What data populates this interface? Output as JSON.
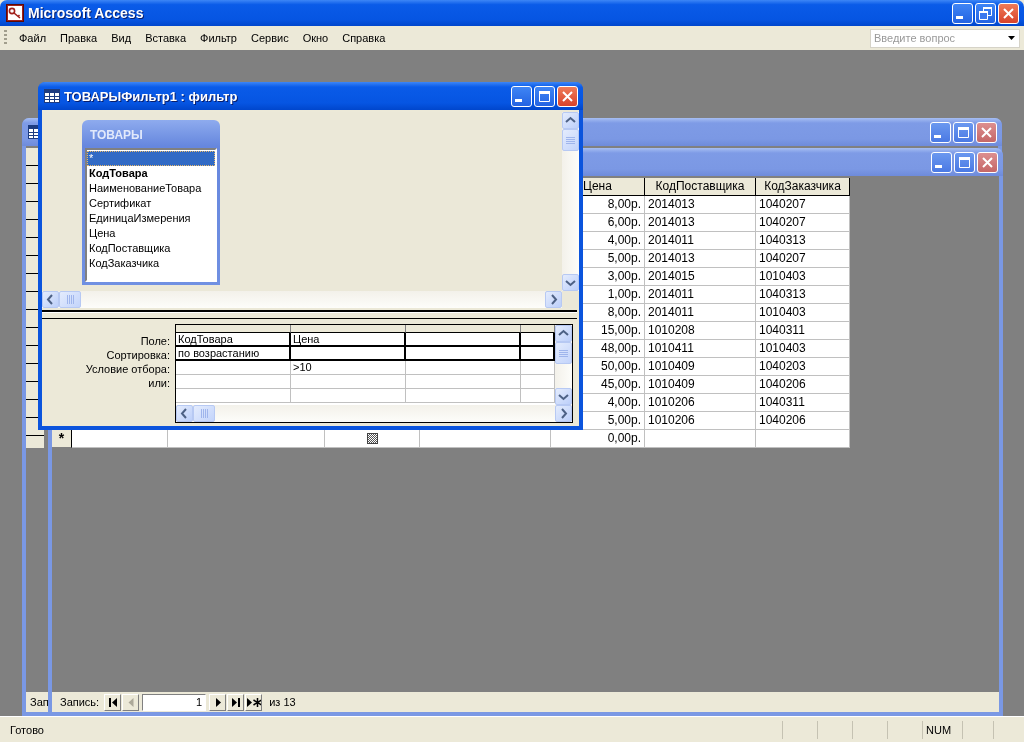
{
  "app": {
    "title": "Microsoft Access",
    "menu": [
      "Файл",
      "Правка",
      "Вид",
      "Вставка",
      "Фильтр",
      "Сервис",
      "Окно",
      "Справка"
    ],
    "help_box": {
      "placeholder": "Введите вопрос"
    }
  },
  "back_window": {
    "navigator_label": "Зап"
  },
  "datasheet_window": {
    "columns": [
      "Цена",
      "КодПоставщика",
      "КодЗаказчика"
    ],
    "rows": [
      [
        "8,00р.",
        "2014013",
        "1040207"
      ],
      [
        "6,00р.",
        "2014013",
        "1040207"
      ],
      [
        "4,00р.",
        "2014011",
        "1040313"
      ],
      [
        "5,00р.",
        "2014013",
        "1040207"
      ],
      [
        "3,00р.",
        "2014015",
        "1010403"
      ],
      [
        "1,00р.",
        "2014011",
        "1040313"
      ],
      [
        "8,00р.",
        "2014011",
        "1010403"
      ],
      [
        "15,00р.",
        "1010208",
        "1040311"
      ],
      [
        "48,00р.",
        "1010411",
        "1010403"
      ],
      [
        "50,00р.",
        "1010409",
        "1040203"
      ],
      [
        "45,00р.",
        "1010409",
        "1040206"
      ],
      [
        "4,00р.",
        "1010206",
        "1040311"
      ],
      [
        "5,00р.",
        "1010206",
        "1040206"
      ]
    ],
    "new_row": {
      "marker": "*",
      "checkbox": {
        "indeterminate": true
      },
      "values": [
        "0,00р."
      ]
    },
    "navigator": {
      "label": "Запись:",
      "current": "1",
      "total": "из 13",
      "buttons": [
        {
          "kind": "first",
          "disabled": false
        },
        {
          "kind": "prev",
          "disabled": true
        },
        {
          "kind": "next",
          "disabled": false
        },
        {
          "kind": "last",
          "disabled": false
        },
        {
          "kind": "new",
          "disabled": false
        }
      ]
    }
  },
  "filter_window": {
    "title": "ТОВАРЫФильтр1 : фильтр",
    "table": {
      "title": "ТОВАРЫ",
      "fields": [
        {
          "name": "*",
          "selected": true,
          "key": false
        },
        {
          "name": "КодТовара",
          "selected": false,
          "key": true
        },
        {
          "name": "НаименованиеТовара",
          "selected": false,
          "key": false
        },
        {
          "name": "Сертификат",
          "selected": false,
          "key": false
        },
        {
          "name": "ЕдиницаИзмерения",
          "selected": false,
          "key": false
        },
        {
          "name": "Цена",
          "selected": false,
          "key": false
        },
        {
          "name": "КодПоставщика",
          "selected": false,
          "key": false
        },
        {
          "name": "КодЗаказчика",
          "selected": false,
          "key": false
        }
      ]
    },
    "grid": {
      "row_labels": [
        "Поле:",
        "Сортировка:",
        "Условие отбора:",
        "или:"
      ],
      "columns": [
        {
          "field": "КодТовара",
          "sort": "по возрастанию"
        },
        {
          "field": "Цена",
          "criteria": ">10"
        }
      ]
    }
  },
  "status_bar": {
    "text": "Готово",
    "indicators": [
      "NUM"
    ]
  }
}
